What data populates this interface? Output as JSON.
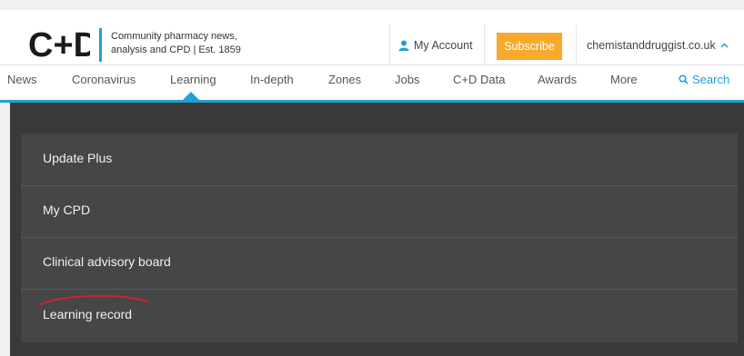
{
  "header": {
    "logo_text": "C+D",
    "tagline_line1": "Community pharmacy news,",
    "tagline_line2": "analysis and CPD | Est. 1859",
    "account_label": "My Account",
    "subscribe_label": "Subscribe",
    "site_label": "chemistanddruggist.co.uk"
  },
  "nav": {
    "items": [
      "News",
      "Coronavirus",
      "Learning",
      "In-depth",
      "Zones",
      "Jobs",
      "C+D Data",
      "Awards",
      "More"
    ],
    "active": "Learning",
    "search_label": "Search"
  },
  "dropdown": {
    "items": [
      "Update Plus",
      "My CPD",
      "Clinical advisory board",
      "Learning record"
    ]
  },
  "colors": {
    "accent": "#1ea0d5",
    "subscribe": "#f7a92c",
    "menu_bg": "#464646",
    "annotation": "#c8262b"
  }
}
